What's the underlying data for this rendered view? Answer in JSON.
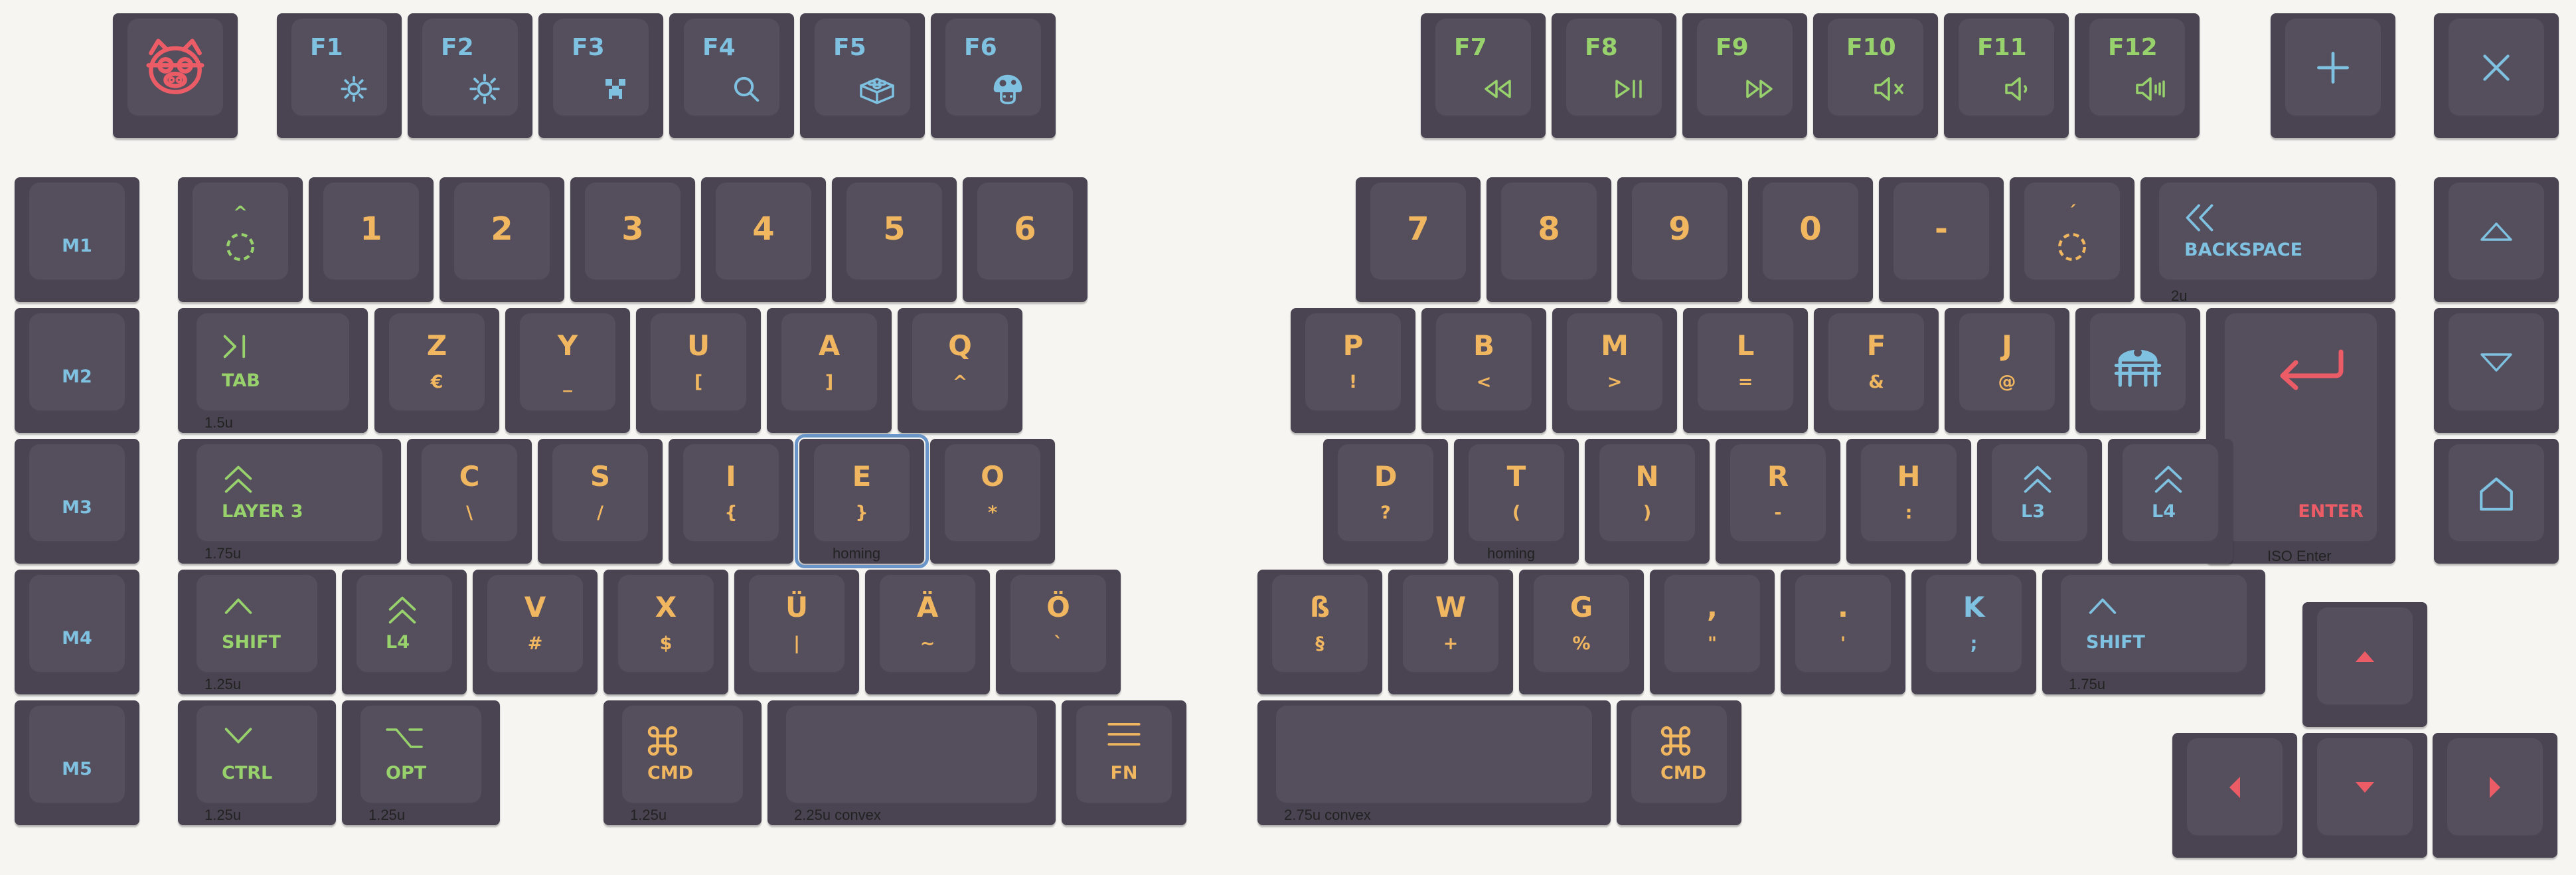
{
  "colors": {
    "background": "#f6f5f2",
    "key": "#4a4351",
    "cap": "#554e5d",
    "orange": "#f1b760",
    "green": "#98d26c",
    "blue": "#7fc1e0",
    "red": "#ec5c66",
    "selected_outline": "#6a95c8"
  },
  "keys": [
    {
      "id": "logo",
      "icon": "pig-face-icon",
      "ic": "r"
    },
    {
      "id": "f1",
      "label": "F1",
      "lc": "b",
      "icon": "brightness-down-icon",
      "ic": "b"
    },
    {
      "id": "f2",
      "label": "F2",
      "lc": "b",
      "icon": "brightness-up-icon",
      "ic": "b"
    },
    {
      "id": "f3",
      "label": "F3",
      "lc": "b",
      "icon": "creeper-icon",
      "ic": "b"
    },
    {
      "id": "f4",
      "label": "F4",
      "lc": "b",
      "icon": "search-icon",
      "ic": "b"
    },
    {
      "id": "f5",
      "label": "F5",
      "lc": "b",
      "icon": "lego-brick-icon",
      "ic": "b"
    },
    {
      "id": "f6",
      "label": "F6",
      "lc": "b",
      "icon": "mushroom-icon",
      "ic": "b"
    },
    {
      "id": "f7",
      "label": "F7",
      "lc": "g",
      "icon": "rewind-icon",
      "ic": "g"
    },
    {
      "id": "f8",
      "label": "F8",
      "lc": "g",
      "icon": "play-pause-icon",
      "ic": "g"
    },
    {
      "id": "f9",
      "label": "F9",
      "lc": "g",
      "icon": "fast-forward-icon",
      "ic": "g"
    },
    {
      "id": "f10",
      "label": "F10",
      "lc": "g",
      "icon": "mute-icon",
      "ic": "g"
    },
    {
      "id": "f11",
      "label": "F11",
      "lc": "g",
      "icon": "volume-down-icon",
      "ic": "g"
    },
    {
      "id": "f12",
      "label": "F12",
      "lc": "g",
      "icon": "volume-up-icon",
      "ic": "g"
    },
    {
      "id": "plus",
      "icon": "plus-icon",
      "ic": "b"
    },
    {
      "id": "close",
      "icon": "close-icon",
      "ic": "b"
    },
    {
      "id": "m1",
      "label": "M1",
      "lc": "b",
      "pos": "c"
    },
    {
      "id": "m2",
      "label": "M2",
      "lc": "b",
      "pos": "c"
    },
    {
      "id": "m3",
      "label": "M3",
      "lc": "b",
      "pos": "c"
    },
    {
      "id": "m4",
      "label": "M4",
      "lc": "b",
      "pos": "c"
    },
    {
      "id": "m5",
      "label": "M5",
      "lc": "b",
      "pos": "c"
    },
    {
      "id": "circumflex",
      "label": "^",
      "lc": "g",
      "icon": "dead-key-circle-icon",
      "ic": "g",
      "pos": "dead"
    },
    {
      "id": "n1",
      "label": "1",
      "lc": "o",
      "pos": "big"
    },
    {
      "id": "n2",
      "label": "2",
      "lc": "o",
      "pos": "big"
    },
    {
      "id": "n3",
      "label": "3",
      "lc": "o",
      "pos": "big"
    },
    {
      "id": "n4",
      "label": "4",
      "lc": "o",
      "pos": "big"
    },
    {
      "id": "n5",
      "label": "5",
      "lc": "o",
      "pos": "big"
    },
    {
      "id": "n6",
      "label": "6",
      "lc": "o",
      "pos": "big"
    },
    {
      "id": "tab",
      "label": "TAB",
      "lc": "g",
      "icon": "tab-arrow-icon",
      "ic": "g",
      "note": "1.5u",
      "pos": "mod"
    },
    {
      "id": "z",
      "label": "Z",
      "lc": "o",
      "sub": "€",
      "pos": "alpha"
    },
    {
      "id": "y",
      "label": "Y",
      "lc": "o",
      "sub": "_",
      "pos": "alpha"
    },
    {
      "id": "u",
      "label": "U",
      "lc": "o",
      "sub": "[",
      "pos": "alpha"
    },
    {
      "id": "a",
      "label": "A",
      "lc": "o",
      "sub": "]",
      "pos": "alpha"
    },
    {
      "id": "q",
      "label": "Q",
      "lc": "o",
      "sub": "^",
      "pos": "alpha"
    },
    {
      "id": "layer3",
      "label": "LAYER 3",
      "lc": "g",
      "icon": "double-chevron-up-icon",
      "ic": "g",
      "note": "1.75u",
      "pos": "mod"
    },
    {
      "id": "c",
      "label": "C",
      "lc": "o",
      "sub": "\\",
      "pos": "alpha"
    },
    {
      "id": "s",
      "label": "S",
      "lc": "o",
      "sub": "/",
      "pos": "alpha"
    },
    {
      "id": "i",
      "label": "I",
      "lc": "o",
      "sub": "{",
      "pos": "alpha"
    },
    {
      "id": "e",
      "label": "E",
      "lc": "o",
      "sub": "}",
      "note": "homing",
      "sel": true,
      "pos": "alpha"
    },
    {
      "id": "o",
      "label": "O",
      "lc": "o",
      "sub": "*",
      "pos": "alpha"
    },
    {
      "id": "lshift",
      "label": "SHIFT",
      "lc": "g",
      "icon": "chevron-up-icon",
      "ic": "g",
      "note": "1.25u",
      "pos": "mod"
    },
    {
      "id": "l4left",
      "label": "L4",
      "lc": "g",
      "icon": "double-chevron-up-icon",
      "ic": "g",
      "pos": "mod"
    },
    {
      "id": "v",
      "label": "V",
      "lc": "o",
      "sub": "#",
      "pos": "alpha"
    },
    {
      "id": "x",
      "label": "X",
      "lc": "o",
      "sub": "$",
      "pos": "alpha"
    },
    {
      "id": "ue",
      "label": "Ü",
      "lc": "o",
      "sub": "|",
      "pos": "alpha"
    },
    {
      "id": "ae",
      "label": "Ä",
      "lc": "o",
      "sub": "~",
      "pos": "alpha"
    },
    {
      "id": "oe",
      "label": "Ö",
      "lc": "o",
      "sub": "`",
      "pos": "alpha"
    },
    {
      "id": "ctrl",
      "label": "CTRL",
      "lc": "g",
      "icon": "chevron-down-icon",
      "ic": "g",
      "note": "1.25u",
      "pos": "mod"
    },
    {
      "id": "opt",
      "label": "OPT",
      "lc": "g",
      "icon": "option-icon",
      "ic": "g",
      "note": "1.25u",
      "pos": "mod"
    },
    {
      "id": "lcmd",
      "label": "CMD",
      "lc": "o",
      "icon": "command-icon",
      "ic": "o",
      "note": "1.25u",
      "pos": "mod"
    },
    {
      "id": "lspace",
      "note": "2.25u convex"
    },
    {
      "id": "fn",
      "label": "FN",
      "lc": "o",
      "icon": "menu-icon",
      "ic": "o",
      "pos": "fn"
    },
    {
      "id": "n7",
      "label": "7",
      "lc": "o",
      "pos": "big"
    },
    {
      "id": "n8",
      "label": "8",
      "lc": "o",
      "pos": "big"
    },
    {
      "id": "n9",
      "label": "9",
      "lc": "o",
      "pos": "big"
    },
    {
      "id": "n0",
      "label": "0",
      "lc": "o",
      "pos": "big"
    },
    {
      "id": "minus",
      "label": "-",
      "lc": "o",
      "pos": "big"
    },
    {
      "id": "acute",
      "label": "´",
      "lc": "o",
      "icon": "dead-key-circle-icon",
      "ic": "o",
      "pos": "dead"
    },
    {
      "id": "backspace",
      "label": "BACKSPACE",
      "lc": "b",
      "icon": "double-chevron-left-icon",
      "ic": "b",
      "note": "2u",
      "pos": "mod"
    },
    {
      "id": "up-panel",
      "icon": "triangle-up-outline-icon",
      "ic": "b"
    },
    {
      "id": "p",
      "label": "P",
      "lc": "o",
      "sub": "!",
      "pos": "alpha"
    },
    {
      "id": "b",
      "label": "B",
      "lc": "o",
      "sub": "<",
      "pos": "alpha"
    },
    {
      "id": "m",
      "label": "M",
      "lc": "o",
      "sub": ">",
      "pos": "alpha"
    },
    {
      "id": "l",
      "label": "L",
      "lc": "o",
      "sub": "=",
      "pos": "alpha"
    },
    {
      "id": "f",
      "label": "F",
      "lc": "o",
      "sub": "&",
      "pos": "alpha"
    },
    {
      "id": "j",
      "label": "J",
      "lc": "o",
      "sub": "@",
      "pos": "alpha"
    },
    {
      "id": "droid",
      "icon": "droid-icon",
      "ic": "b"
    },
    {
      "id": "enter",
      "label": "ENTER",
      "lc": "r",
      "icon": "enter-arrow-icon",
      "ic": "r",
      "note": "ISO Enter",
      "pos": "enter"
    },
    {
      "id": "down-panel",
      "icon": "triangle-down-outline-icon",
      "ic": "b"
    },
    {
      "id": "d",
      "label": "D",
      "lc": "o",
      "sub": "?",
      "pos": "alpha"
    },
    {
      "id": "t",
      "label": "T",
      "lc": "o",
      "sub": "(",
      "note": "homing",
      "pos": "alpha"
    },
    {
      "id": "n",
      "label": "N",
      "lc": "o",
      "sub": ")",
      "pos": "alpha"
    },
    {
      "id": "r",
      "label": "R",
      "lc": "o",
      "sub": "-",
      "pos": "alpha"
    },
    {
      "id": "h",
      "label": "H",
      "lc": "o",
      "sub": ":",
      "pos": "alpha"
    },
    {
      "id": "l3",
      "label": "L3",
      "lc": "b",
      "icon": "double-chevron-up-icon",
      "ic": "b",
      "pos": "mod"
    },
    {
      "id": "l4right",
      "label": "L4",
      "lc": "b",
      "icon": "double-chevron-up-icon",
      "ic": "b",
      "pos": "mod"
    },
    {
      "id": "home",
      "icon": "home-icon",
      "ic": "b"
    },
    {
      "id": "sz",
      "label": "ß",
      "lc": "o",
      "sub": "§",
      "pos": "alpha"
    },
    {
      "id": "w",
      "label": "W",
      "lc": "o",
      "sub": "+",
      "pos": "alpha"
    },
    {
      "id": "g",
      "label": "G",
      "lc": "o",
      "sub": "%",
      "pos": "alpha"
    },
    {
      "id": "comma",
      "label": ",",
      "lc": "o",
      "sub": "\"",
      "pos": "alpha"
    },
    {
      "id": "period",
      "label": ".",
      "lc": "o",
      "sub": "'",
      "pos": "alpha"
    },
    {
      "id": "k",
      "label": "K",
      "lc": "b",
      "sub": ";",
      "sc": "b",
      "pos": "alpha"
    },
    {
      "id": "rshift",
      "label": "SHIFT",
      "lc": "b",
      "icon": "chevron-up-icon",
      "ic": "b",
      "note": "1.75u",
      "pos": "mod"
    },
    {
      "id": "arrow-up",
      "icon": "arrow-up-icon",
      "ic": "r"
    },
    {
      "id": "rspace",
      "note": "2.75u convex"
    },
    {
      "id": "rcmd",
      "label": "CMD",
      "lc": "o",
      "icon": "command-icon",
      "ic": "o",
      "pos": "mod"
    },
    {
      "id": "arrow-left",
      "icon": "arrow-left-icon",
      "ic": "r"
    },
    {
      "id": "arrow-down",
      "icon": "arrow-down-icon",
      "ic": "r"
    },
    {
      "id": "arrow-right",
      "icon": "arrow-right-icon",
      "ic": "r"
    }
  ]
}
